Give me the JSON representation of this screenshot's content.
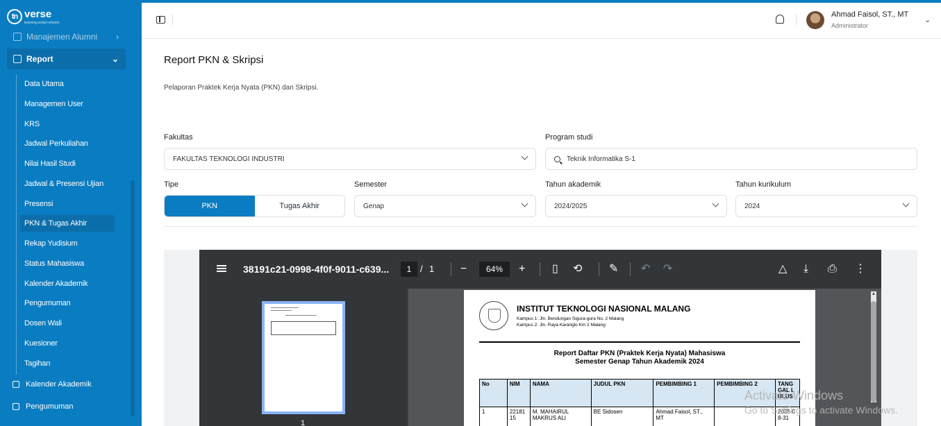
{
  "brand": {
    "logo_mark": "tn",
    "name": "verse",
    "tagline": "learning portal network"
  },
  "sidebar": {
    "parents": [
      {
        "label": "Manajemen Alumni"
      },
      {
        "label": "Report"
      }
    ],
    "report_items": [
      {
        "label": "Data Utama"
      },
      {
        "label": "Managemen User"
      },
      {
        "label": "KRS"
      },
      {
        "label": "Jadwal Perkuliahan"
      },
      {
        "label": "Nilai Hasil Studi"
      },
      {
        "label": "Jadwal & Presensi Ujian"
      },
      {
        "label": "Presensi"
      },
      {
        "label": "PKN & Tugas Akhir"
      },
      {
        "label": "Rekap Yudisium"
      },
      {
        "label": "Status Mahasiswa"
      },
      {
        "label": "Kalender Akademik"
      },
      {
        "label": "Pengumuman"
      },
      {
        "label": "Dosen Wali"
      },
      {
        "label": "Kuesioner"
      },
      {
        "label": "Tagihan"
      }
    ],
    "bottom_items": [
      {
        "label": "Kalender Akademik"
      },
      {
        "label": "Pengumuman"
      }
    ],
    "active_item": "PKN & Tugas Akhir"
  },
  "header": {
    "user_name": "Ahmad Faisol, ST., MT",
    "user_role": "Administrator"
  },
  "page": {
    "title": "Report PKN & Skripsi",
    "description": "Pelaporan Praktek Kerja Nyata (PKN) dan Skripsi."
  },
  "filters": {
    "fakultas": {
      "label": "Fakultas",
      "value": "FAKULTAS TEKNOLOGI INDUSTRI"
    },
    "prodi": {
      "label": "Program studi",
      "value": "Teknik Informatika S-1"
    },
    "tipe": {
      "label": "Tipe",
      "options": [
        "PKN",
        "Tugas Akhir"
      ],
      "selected": "PKN"
    },
    "semester": {
      "label": "Semester",
      "value": "Genap"
    },
    "tahun_akademik": {
      "label": "Tahun akademik",
      "value": "2024/2025"
    },
    "tahun_kurikulum": {
      "label": "Tahun kurikulum",
      "value": "2024"
    }
  },
  "pdf_viewer": {
    "file_name": "38191c21-0998-4f0f-9011-c639...",
    "current_page": "1",
    "page_separator": "/",
    "total_pages": "1",
    "zoom": "64%",
    "thumbnail_number": "1",
    "document": {
      "institution": "INSTITUT TEKNOLOGI NASIONAL MALANG",
      "address_1": "Kampus 1: Jln. Bendungan Sigura-gura No. 2 Malang",
      "address_2": "Kampus 2: Jln. Raya Karanglo Km 2 Malang",
      "title_1": "Report Daftar PKN (Praktek Kerja Nyata) Mahasiswa",
      "title_2": "Semester Genap Tahun Akademik 2024",
      "columns": [
        "No",
        "NIM",
        "NAMA",
        "JUDUL PKN",
        "PEMBIMBING 1",
        "PEMBIMBING 2",
        "TANG GAL L ULUS"
      ],
      "rows": [
        [
          "1",
          "22181 15",
          "M. MAHAIRUL MAKRUS ALI",
          "BE Sidosen",
          "Ahmad Faisol, ST., MT",
          "",
          "2025-0 8-31"
        ]
      ]
    }
  },
  "watermark": {
    "line1": "Activate Windows",
    "line2": "Go to Settings to activate Windows."
  },
  "colors": {
    "primary": "#0a7cc1",
    "viewer_bar": "#323639",
    "table_header": "#d6e6f2"
  }
}
